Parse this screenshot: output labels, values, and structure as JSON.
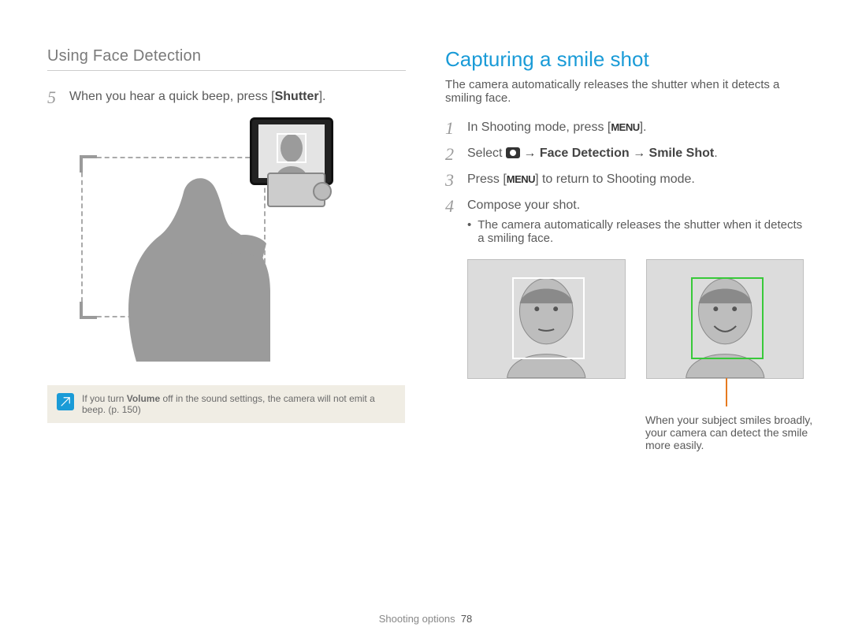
{
  "header": "Using Face Detection",
  "left": {
    "step5_num": "5",
    "step5_prefix": "When you hear a quick beep, press [",
    "step5_bold": "Shutter",
    "step5_suffix": "].",
    "note_prefix": "If you turn ",
    "note_bold": "Volume",
    "note_suffix": " off in the sound settings, the camera will not emit a beep. (p. 150)"
  },
  "right": {
    "title": "Capturing a smile shot",
    "lead": "The camera automatically releases the shutter when it detects a smiling face.",
    "step1_num": "1",
    "step1_prefix": "In Shooting mode, press [",
    "step1_suffix": "].",
    "step2_num": "2",
    "step2_prefix": "Select ",
    "step2_bold": " → Face Detection → Smile Shot",
    "step2_suffix": ".",
    "step3_num": "3",
    "step3_prefix": "Press [",
    "step3_suffix": "] to return to Shooting mode.",
    "step4_num": "4",
    "step4_text": "Compose your shot.",
    "step4_bullet": "The camera automatically releases the shutter when it detects a smiling face.",
    "caption": "When your subject smiles broadly, your camera can detect the smile more easily.",
    "menu_label": "MENU"
  },
  "footer": {
    "section": "Shooting options",
    "page": "78"
  }
}
